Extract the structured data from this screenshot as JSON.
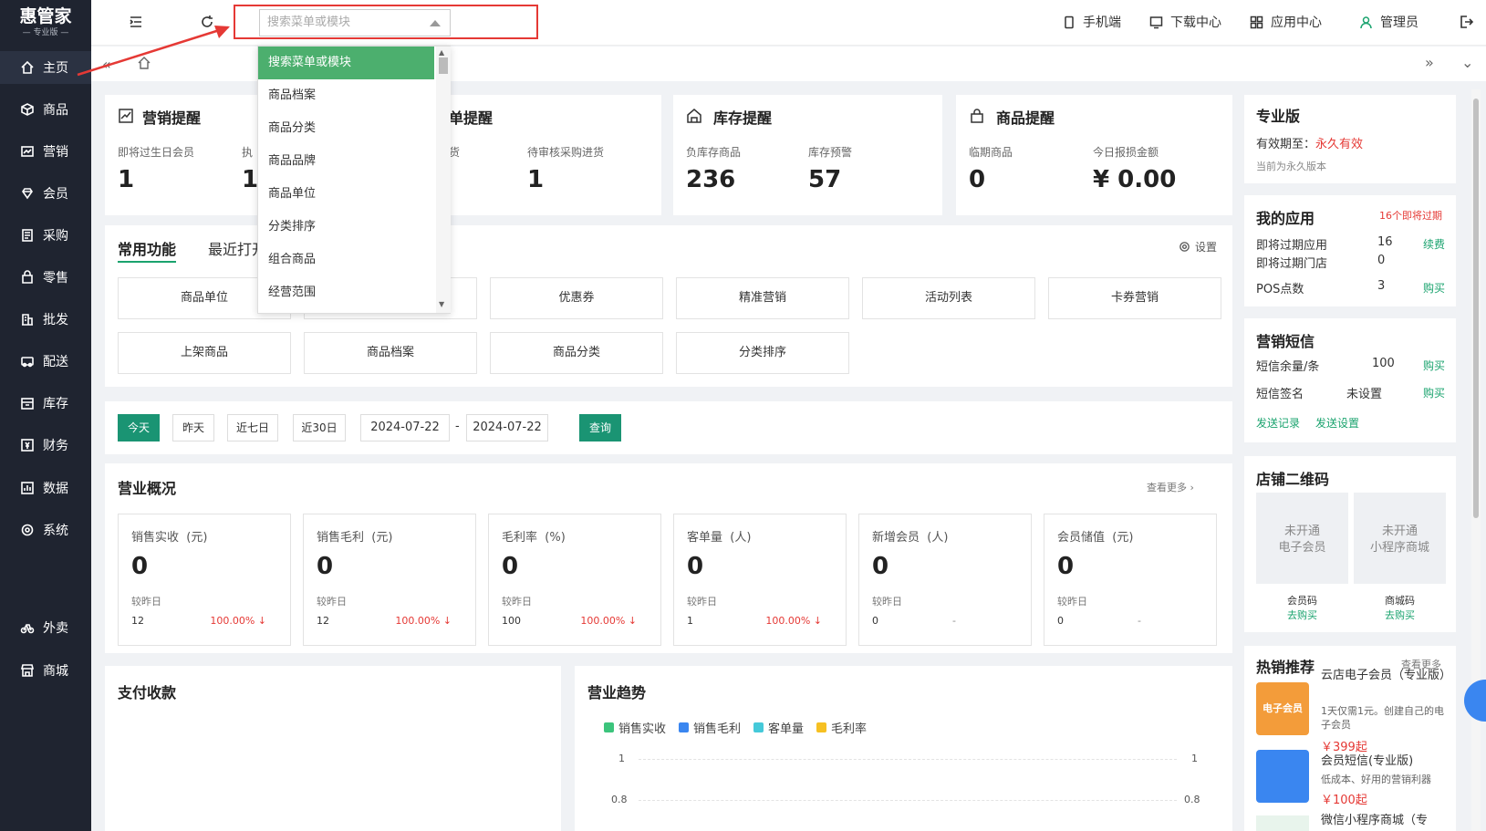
{
  "sidebar": {
    "brand": "惠管家",
    "edition": "— 专业版 —",
    "items": [
      {
        "label": "主页"
      },
      {
        "label": "商品"
      },
      {
        "label": "营销"
      },
      {
        "label": "会员"
      },
      {
        "label": "采购"
      },
      {
        "label": "零售"
      },
      {
        "label": "批发"
      },
      {
        "label": "配送"
      },
      {
        "label": "库存"
      },
      {
        "label": "财务"
      },
      {
        "label": "数据"
      },
      {
        "label": "系统"
      },
      {
        "label": "外卖"
      },
      {
        "label": "商城"
      }
    ]
  },
  "header": {
    "search_placeholder": "搜索菜单或模块",
    "links": [
      "手机端",
      "下载中心",
      "应用中心",
      "管理员"
    ]
  },
  "dropdown": {
    "items": [
      "搜索菜单或模块",
      "商品档案",
      "商品分类",
      "商品品牌",
      "商品单位",
      "分类排序",
      "组合商品",
      "经营范围"
    ]
  },
  "reminders": {
    "marketing": {
      "title": "营销提醒",
      "label1": "即将过生日会员",
      "value1": "1",
      "label2": "执",
      "value2": "1"
    },
    "purchase": {
      "title": "单提醒",
      "label1": "货",
      "label2": "待审核采购进货",
      "value2": "1"
    },
    "stock": {
      "title": "库存提醒",
      "label1": "负库存商品",
      "value1": "236",
      "label2": "库存预警",
      "value2": "57"
    },
    "goods": {
      "title": "商品提醒",
      "label1": "临期商品",
      "value1": "0",
      "label2": "今日报损金额",
      "value2": "¥ 0.00"
    }
  },
  "functions": {
    "tab_common": "常用功能",
    "tab_recent": "最近打开",
    "settings": "设置",
    "row1": [
      "商品单位",
      "",
      "优惠券",
      "精准营销",
      "活动列表",
      "卡券营销"
    ],
    "row2": [
      "上架商品",
      "商品档案",
      "商品分类",
      "分类排序"
    ]
  },
  "filter": {
    "today": "今天",
    "yesterday": "昨天",
    "week": "近七日",
    "month": "近30日",
    "start": "2024-07-22",
    "sep": "-",
    "end": "2024-07-22",
    "query": "查询"
  },
  "overview": {
    "title": "营业概况",
    "more": "查看更多",
    "stats": [
      {
        "title": "销售实收",
        "unit": "(元)",
        "value": "0",
        "compare": "较昨日",
        "yesterday": "12",
        "pct": "100.00%",
        "arrow": "↓"
      },
      {
        "title": "销售毛利",
        "unit": "(元)",
        "value": "0",
        "compare": "较昨日",
        "yesterday": "12",
        "pct": "100.00%",
        "arrow": "↓"
      },
      {
        "title": "毛利率",
        "unit": "(%)",
        "value": "0",
        "compare": "较昨日",
        "yesterday": "100",
        "pct": "100.00%",
        "arrow": "↓"
      },
      {
        "title": "客单量",
        "unit": "(人)",
        "value": "0",
        "compare": "较昨日",
        "yesterday": "1",
        "pct": "100.00%",
        "arrow": "↓"
      },
      {
        "title": "新增会员",
        "unit": "(人)",
        "value": "0",
        "compare": "较昨日",
        "yesterday": "0",
        "pct": "-",
        "arrow": ""
      },
      {
        "title": "会员储值",
        "unit": "(元)",
        "value": "0",
        "compare": "较昨日",
        "yesterday": "0",
        "pct": "-",
        "arrow": ""
      }
    ]
  },
  "payment": {
    "title": "支付收款"
  },
  "trend": {
    "title": "营业趋势",
    "legend": [
      {
        "name": "销售实收",
        "color": "#3cc47c"
      },
      {
        "name": "销售毛利",
        "color": "#3a86f0"
      },
      {
        "name": "客单量",
        "color": "#45c9d9"
      },
      {
        "name": "毛利率",
        "color": "#f6c022"
      }
    ],
    "y_ticks": [
      "1",
      "0.8"
    ]
  },
  "pro": {
    "title": "专业版",
    "valid_label": "有效期至：",
    "valid_value": "永久有效",
    "note": "当前为永久版本"
  },
  "apps": {
    "title": "我的应用",
    "badge": "16个即将过期",
    "rows": [
      {
        "label": "即将过期应用",
        "value": "16",
        "action": "续费"
      },
      {
        "label": "即将过期门店",
        "value": "0",
        "action": ""
      },
      {
        "label": "POS点数",
        "value": "3",
        "action": "购买"
      }
    ]
  },
  "sms": {
    "title": "营销短信",
    "rows": [
      {
        "label": "短信余量/条",
        "value": "100",
        "action": "购买"
      },
      {
        "label": "短信签名",
        "value": "未设置",
        "action": "购买"
      }
    ],
    "link1": "发送记录",
    "link2": "发送设置"
  },
  "qrcode": {
    "title": "店铺二维码",
    "box1": [
      "未开通",
      "电子会员"
    ],
    "box2": [
      "未开通",
      "小程序商城"
    ],
    "label1": "会员码",
    "buy1": "去购买",
    "label2": "商城码",
    "buy2": "去购买"
  },
  "hot": {
    "title": "热销推荐",
    "more": "查看更多",
    "items": [
      {
        "name": "云店电子会员（专业版）",
        "desc": "1天仅需1元。创建自己的电子会员",
        "price": "￥399起",
        "thumb": "电子会员"
      },
      {
        "name": "会员短信(专业版)",
        "desc": "低成本、好用的营销利器",
        "price": "￥100起",
        "thumb": ""
      },
      {
        "name": "微信小程序商城（专",
        "desc": "",
        "price": "",
        "thumb": ""
      }
    ]
  }
}
